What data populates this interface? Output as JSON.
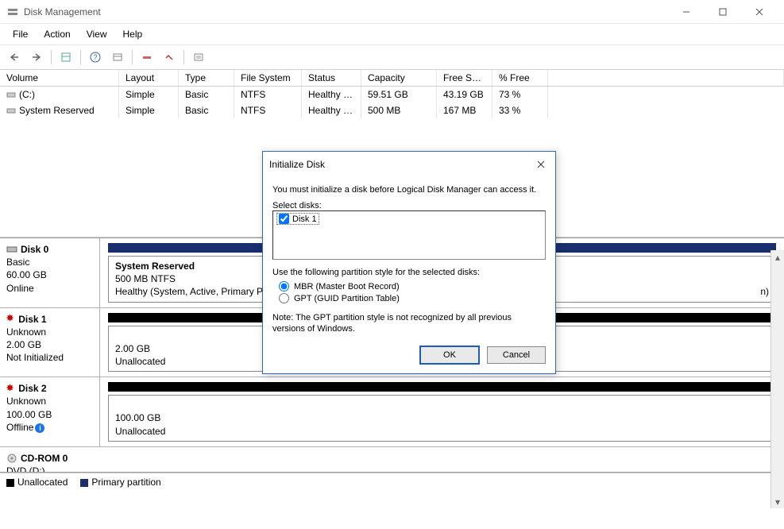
{
  "window": {
    "title": "Disk Management"
  },
  "menu": {
    "file": "File",
    "action": "Action",
    "view": "View",
    "help": "Help"
  },
  "columns": {
    "volume": "Volume",
    "layout": "Layout",
    "type": "Type",
    "fs": "File System",
    "status": "Status",
    "capacity": "Capacity",
    "free": "Free Spa...",
    "pct": "% Free"
  },
  "volumes": [
    {
      "name": "(C:)",
      "layout": "Simple",
      "type": "Basic",
      "fs": "NTFS",
      "status": "Healthy (B...",
      "capacity": "59.51 GB",
      "free": "43.19 GB",
      "pct": "73 %"
    },
    {
      "name": "System Reserved",
      "layout": "Simple",
      "type": "Basic",
      "fs": "NTFS",
      "status": "Healthy (S...",
      "capacity": "500 MB",
      "free": "167 MB",
      "pct": "33 %"
    }
  ],
  "disks": [
    {
      "name": "Disk 0",
      "type": "Basic",
      "size": "60.00 GB",
      "state": "Online",
      "partitions": [
        {
          "title": "System Reserved",
          "sub": "500 MB NTFS",
          "health": "Healthy (System, Active, Primary Pa",
          "bar": "navy",
          "grow": 0.08
        },
        {
          "title": "",
          "sub": "",
          "health": "n)",
          "bar": "navy",
          "grow": 0.92,
          "continuation": true
        }
      ]
    },
    {
      "name": "Disk 1",
      "type": "Unknown",
      "size": "2.00 GB",
      "state": "Not Initialized",
      "warn": true,
      "partitions": [
        {
          "title": "",
          "sub": "2.00 GB",
          "health": "Unallocated",
          "bar": "black",
          "grow": 1
        }
      ]
    },
    {
      "name": "Disk 2",
      "type": "Unknown",
      "size": "100.00 GB",
      "state": "Offline",
      "warn": true,
      "info": true,
      "partitions": [
        {
          "title": "",
          "sub": "100.00 GB",
          "health": "Unallocated",
          "bar": "black",
          "grow": 1
        }
      ]
    },
    {
      "name": "CD-ROM 0",
      "type": "DVD (D:)",
      "size": "",
      "state": "",
      "cdrom": true,
      "partitions": []
    }
  ],
  "legend": {
    "unalloc": "Unallocated",
    "primary": "Primary partition"
  },
  "dialog": {
    "title": "Initialize Disk",
    "msg": "You must initialize a disk before Logical Disk Manager can access it.",
    "select_label": "Select disks:",
    "disk_item": "Disk 1",
    "style_label": "Use the following partition style for the selected disks:",
    "mbr": "MBR (Master Boot Record)",
    "gpt": "GPT (GUID Partition Table)",
    "note": "Note: The GPT partition style is not recognized by all previous versions of Windows.",
    "ok": "OK",
    "cancel": "Cancel"
  }
}
